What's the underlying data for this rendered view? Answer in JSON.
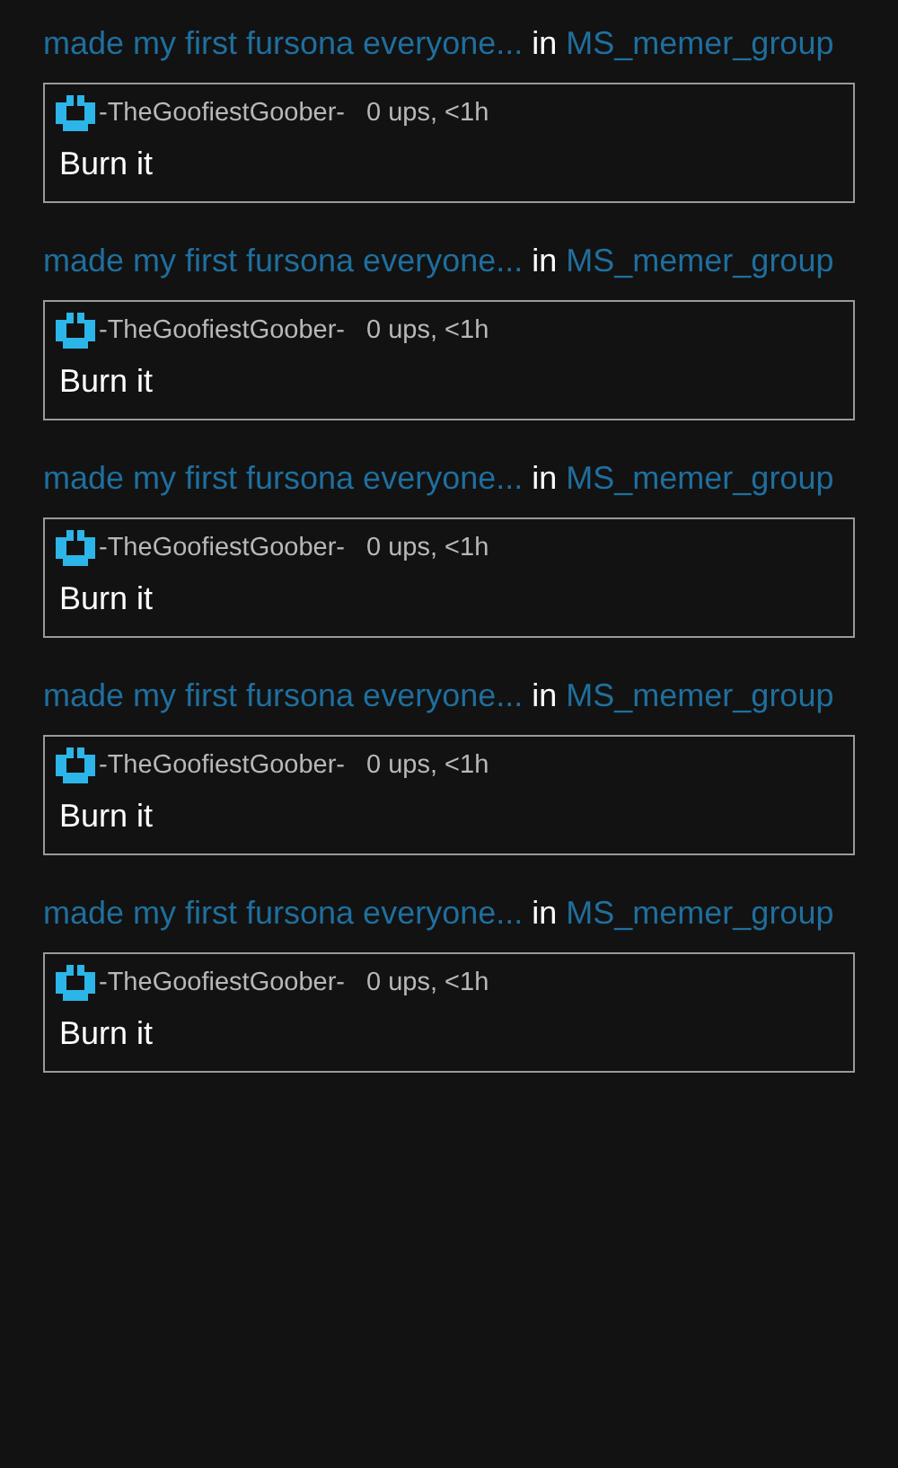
{
  "comments": [
    {
      "post_title": "made my first fursona everyone...",
      "in_label": "in",
      "stream": "MS_memer_group",
      "author": "-TheGoofiestGoober-",
      "meta": "0 ups, <1h",
      "text": "Burn it"
    },
    {
      "post_title": "made my first fursona everyone...",
      "in_label": "in",
      "stream": "MS_memer_group",
      "author": "-TheGoofiestGoober-",
      "meta": "0 ups, <1h",
      "text": "Burn it"
    },
    {
      "post_title": "made my first fursona everyone...",
      "in_label": "in",
      "stream": "MS_memer_group",
      "author": "-TheGoofiestGoober-",
      "meta": "0 ups, <1h",
      "text": "Burn it"
    },
    {
      "post_title": "made my first fursona everyone...",
      "in_label": "in",
      "stream": "MS_memer_group",
      "author": "-TheGoofiestGoober-",
      "meta": "0 ups, <1h",
      "text": "Burn it"
    },
    {
      "post_title": "made my first fursona everyone...",
      "in_label": "in",
      "stream": "MS_memer_group",
      "author": "-TheGoofiestGoober-",
      "meta": "0 ups, <1h",
      "text": "Burn it"
    }
  ]
}
